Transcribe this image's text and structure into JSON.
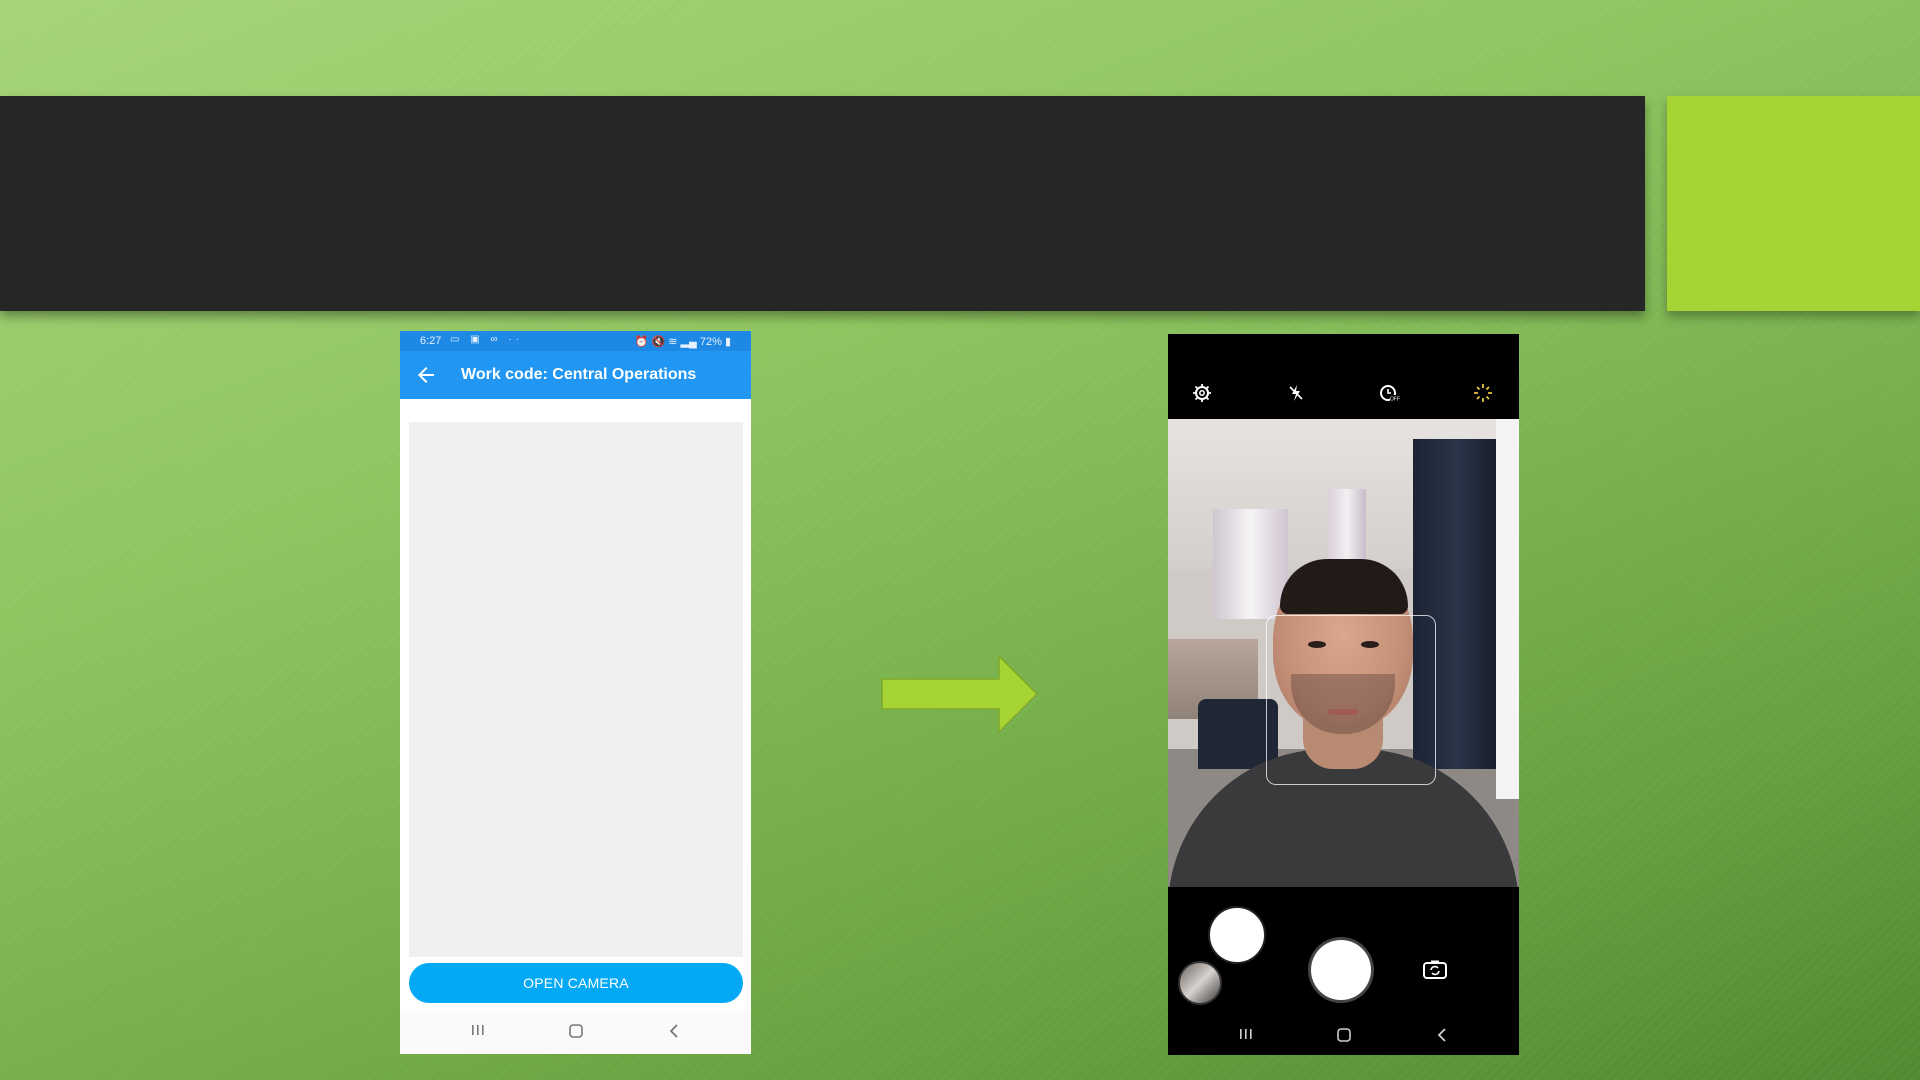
{
  "phone1": {
    "status_time": "6:27",
    "status_icons_left": "▭ ▣ ∞ ··",
    "battery_text": "72%",
    "status_icons_right": "⏰ 🔇 ≋ ▂▄",
    "title": "Work code: Central Operations",
    "back_icon": "arrow-left-icon",
    "button_label": "OPEN CAMERA",
    "nav": [
      "recent-apps-icon",
      "home-icon",
      "back-icon"
    ]
  },
  "phone2": {
    "top_icons": [
      "settings-icon",
      "flash-off-icon",
      "timer-off-icon",
      "filter-effects-icon"
    ],
    "bottom_icons": [
      "gallery-thumbnail",
      "shutter-button",
      "switch-camera-icon"
    ],
    "nav": [
      "recent-apps-icon",
      "home-icon",
      "back-icon"
    ]
  },
  "colors": {
    "title_bar": "#262626",
    "accent": "#a6d435",
    "app_bar": "#2196f3",
    "button": "#03a9f4"
  }
}
